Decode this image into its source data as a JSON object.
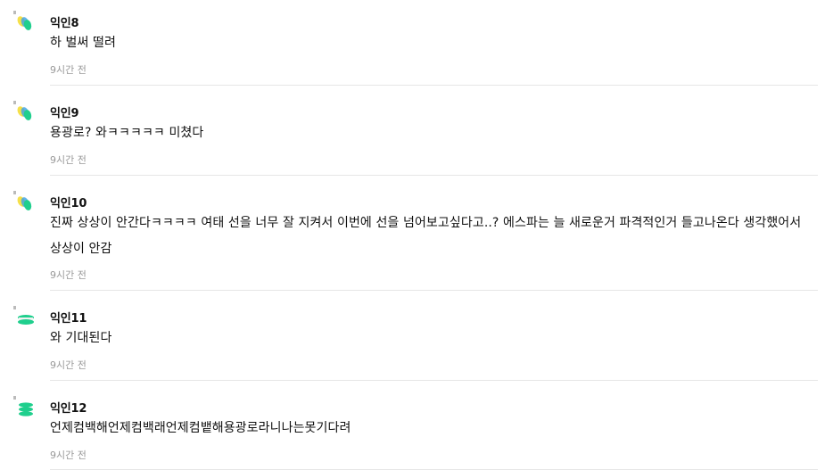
{
  "comments": [
    {
      "nickname": "익인8",
      "text": "하 벌써 떨려",
      "time": "9시간 전",
      "avatar_icon": "butterfly-icon"
    },
    {
      "nickname": "익인9",
      "text": "용광로? 와ㅋㅋㅋㅋㅋ 미쳤다",
      "time": "9시간 전",
      "avatar_icon": "butterfly-icon"
    },
    {
      "nickname": "익인10",
      "text": "진짜 상상이 안간다ㅋㅋㅋㅋ 여태 선을 너무 잘 지켜서 이번에 선을 넘어보고싶다고..? 에스파는 늘 새로운거 파격적인거 들고나온다 생각했어서 상상이 안감",
      "time": "9시간 전",
      "avatar_icon": "butterfly-icon"
    },
    {
      "nickname": "익인11",
      "text": "와 기대된다",
      "time": "9시간 전",
      "avatar_icon": "macaron-icon"
    },
    {
      "nickname": "익인12",
      "text": "언제컴백해언제컴백래언제컴뱉해용광로라니나는못기다려",
      "time": "9시간 전",
      "avatar_icon": "macaron-stack-icon"
    }
  ],
  "colors": {
    "avatar_green": "#1fcf8d",
    "avatar_yellow": "#f5e04a",
    "avatar_blue": "#3aa0e8",
    "time_gray": "#999999",
    "divider": "#e6e6e6"
  }
}
